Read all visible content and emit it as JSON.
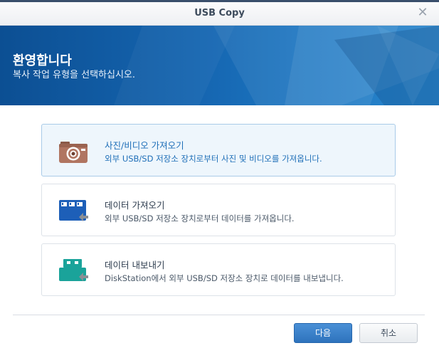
{
  "window": {
    "title": "USB Copy"
  },
  "banner": {
    "heading": "환영합니다",
    "subtitle": "복사 작업 유형을 선택하십시오."
  },
  "options": [
    {
      "title": "사진/비디오 가져오기",
      "description": "외부 USB/SD 저장소 장치로부터 사진 및 비디오를 가져옵니다.",
      "icon": "camera-icon",
      "selected": true
    },
    {
      "title": "데이터 가져오기",
      "description": "외부 USB/SD 저장소 장치로부터 데이터를 가져옵니다.",
      "icon": "import-data-icon",
      "selected": false
    },
    {
      "title": "데이터 내보내기",
      "description": "DiskStation에서 외부 USB/SD 저장소 장치로 데이터를 내보냅니다.",
      "icon": "export-data-icon",
      "selected": false
    }
  ],
  "buttons": {
    "next": "다음",
    "cancel": "취소"
  },
  "colors": {
    "accent": "#2e73bd",
    "banner": "#1565b0",
    "selected_bg": "#eef6fc"
  }
}
